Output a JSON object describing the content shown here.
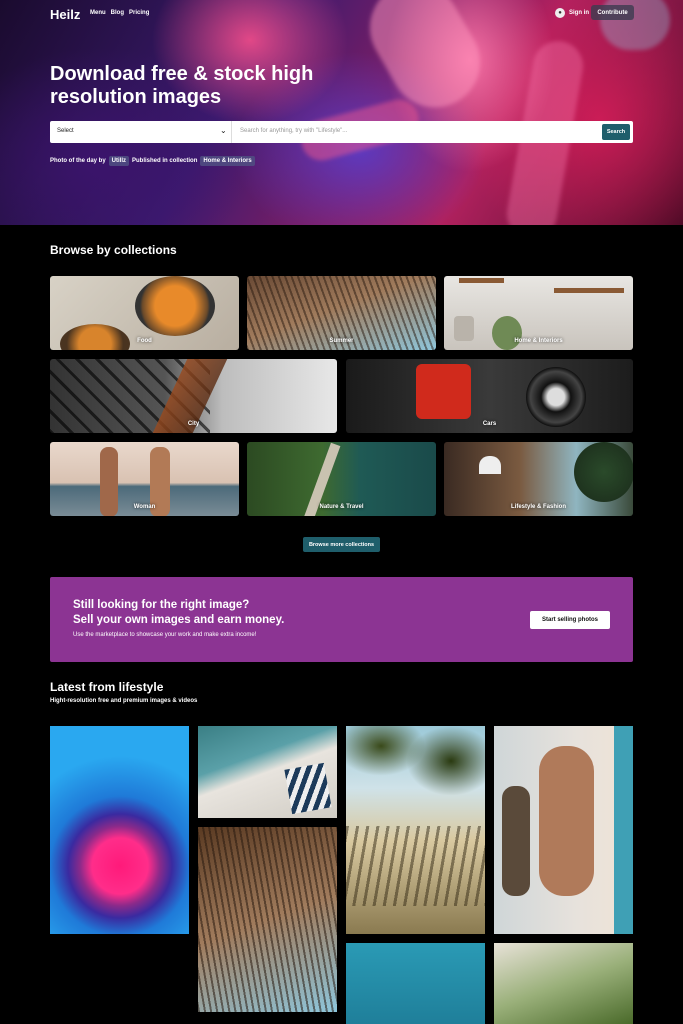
{
  "nav": {
    "logo": "Heilz",
    "links": [
      "Menu",
      "Blog",
      "Pricing"
    ],
    "signin": "Sign in",
    "contribute": "Contribute"
  },
  "hero": {
    "title": "Download free & stock high resolution images",
    "select_label": "Select",
    "search_placeholder": "Search for anything, try with \"Lifestyle\"...",
    "search_button": "Search",
    "photo_of_day_prefix": "Photo of the day by",
    "photo_author": "Utillz",
    "published_in": "Published in collection",
    "collection": "Home & Interiors"
  },
  "collections": {
    "title": "Browse by collections",
    "items": [
      "Food",
      "Summer",
      "Home & Interiors",
      "City",
      "Cars",
      "Woman",
      "Nature & Travel",
      "Lifestyle & Fashion"
    ],
    "browse_more": "Browse more collections"
  },
  "promo": {
    "line1": "Still looking for the right image?",
    "line2": "Sell your own images and earn money.",
    "sub": "Use the marketplace to showcase your work and make extra income!",
    "button": "Start selling photos"
  },
  "latest": {
    "title": "Latest from lifestyle",
    "subtitle": "Hight-resolution free and premium images & videos"
  },
  "colors": {
    "accent": "#1f5e6b",
    "promo": "#8c3493",
    "background": "#000000"
  }
}
